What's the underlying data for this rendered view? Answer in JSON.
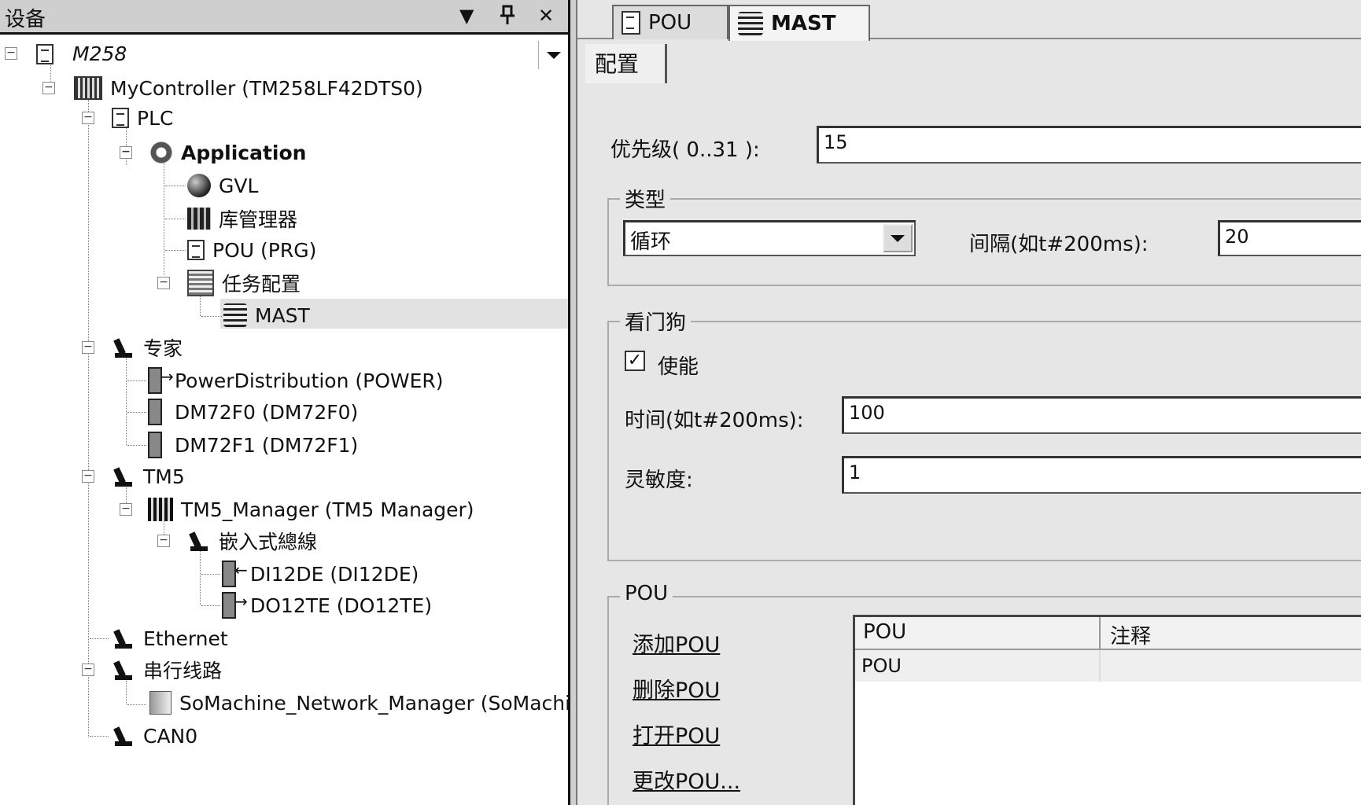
{
  "devices_panel": {
    "title": "设备",
    "buttons": {
      "dropdown": "▼",
      "pin": "❁",
      "close": "✕"
    },
    "context": "M258",
    "tree": [
      {
        "label": "MyController (TM258LF42DTS0)"
      },
      {
        "label": "PLC"
      },
      {
        "label": "Application",
        "bold": true
      },
      {
        "label": "GVL"
      },
      {
        "label": "库管理器"
      },
      {
        "label": "POU (PRG)"
      },
      {
        "label": "任务配置"
      },
      {
        "label": "MAST",
        "selected": true
      },
      {
        "label": "专家"
      },
      {
        "label": "PowerDistribution (POWER)"
      },
      {
        "label": "DM72F0 (DM72F0)"
      },
      {
        "label": "DM72F1 (DM72F1)"
      },
      {
        "label": "TM5"
      },
      {
        "label": "TM5_Manager (TM5 Manager)"
      },
      {
        "label": "嵌入式總線"
      },
      {
        "label": "DI12DE (DI12DE)"
      },
      {
        "label": "DO12TE (DO12TE)"
      },
      {
        "label": "Ethernet"
      },
      {
        "label": "串行线路"
      },
      {
        "label": "SoMachine_Network_Manager (SoMachine"
      },
      {
        "label": "CAN0"
      }
    ]
  },
  "editor": {
    "tabs": [
      {
        "label": "POU"
      },
      {
        "label": "MAST",
        "active": true
      }
    ],
    "subtab": "配置",
    "priority": {
      "label": "优先级( 0..31 ):",
      "value": "15"
    },
    "type_group": {
      "legend": "类型",
      "selected": "循环",
      "interval_label": "间隔(如t#200ms):",
      "interval_value": "20"
    },
    "watchdog": {
      "legend": "看门狗",
      "enable_label": "使能",
      "enabled": true,
      "time_label": "时间(如t#200ms):",
      "time_value": "100",
      "sensitivity_label": "灵敏度:",
      "sensitivity_value": "1"
    },
    "pou_group": {
      "legend": "POU",
      "links": [
        "添加POU",
        "删除POU",
        "打开POU",
        "更改POU..."
      ],
      "columns": [
        "POU",
        "注释"
      ],
      "rows": [
        {
          "pou": "POU",
          "comment": ""
        }
      ]
    }
  }
}
